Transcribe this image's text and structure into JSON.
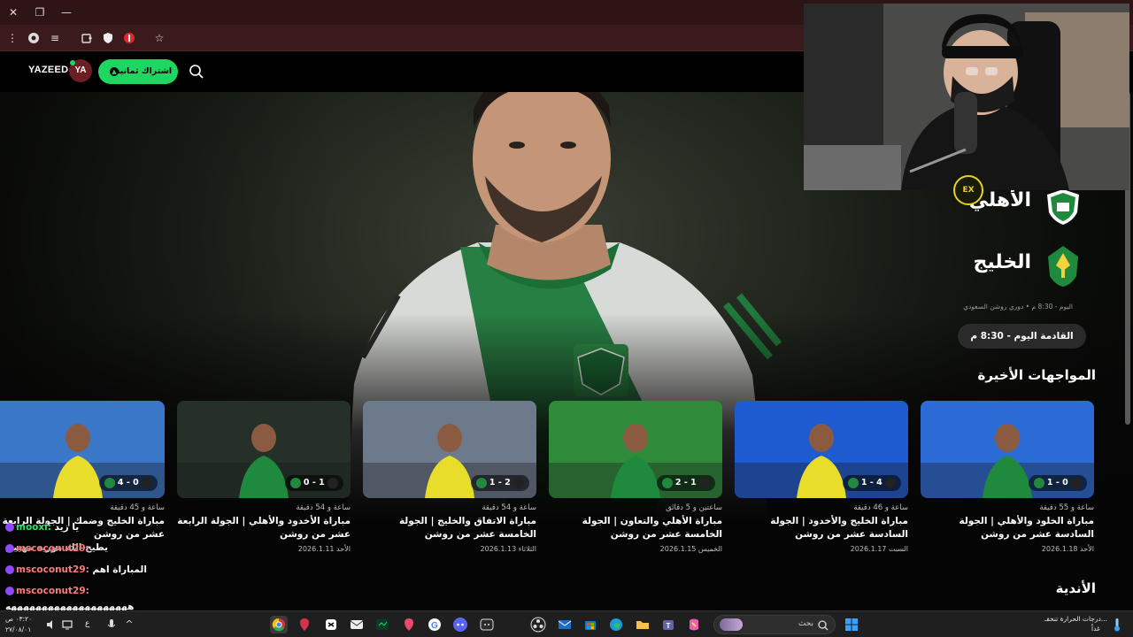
{
  "browser": {
    "window_controls": [
      "✕",
      "❐",
      "—"
    ],
    "menu_icon": "more-vert-icon",
    "bookmark_icon": "star-icon"
  },
  "header": {
    "username": "YAZEED",
    "avatar_initials": "YA",
    "subscribe_label": "اشتراك ثمانية"
  },
  "featured": {
    "team_home": "الأهلي",
    "team_away": "الخليج",
    "meta": "اليوم - 8:30 م • دوري روشن السعودي",
    "upcoming": "القادمة اليوم - 8:30 م"
  },
  "recent": {
    "title": "المواجهات الأخيرة",
    "cards": [
      {
        "ago": "ساعة و 55 دقيقة",
        "title": "مباراة الخلود والأهلي | الجولة السادسة عشر من روشن",
        "date": "الأحد 2026.1.18",
        "score": "1 - 0",
        "accent": "#2b6bd6"
      },
      {
        "ago": "ساعة و 46 دقيقة",
        "title": "مباراة الخليج والأخدود | الجولة السادسة عشر من روشن",
        "date": "السبت 2026.1.17",
        "score": "1 - 4",
        "accent": "#1e5bd0"
      },
      {
        "ago": "ساعتين و 5 دقائق",
        "title": "مباراة الأهلي والتعاون | الجولة الخامسة عشر من روشن",
        "date": "الخميس 2026.1.15",
        "score": "2 - 1",
        "accent": "#2f8a3a"
      },
      {
        "ago": "ساعة و 54 دقيقة",
        "title": "مباراة الاتفاق والخليج | الجولة الخامسة عشر من روشن",
        "date": "الثلاثاء 2026.1.13",
        "score": "1 - 2",
        "accent": "#6c7a8c"
      },
      {
        "ago": "ساعة و 54 دقيقة",
        "title": "مباراة الأخدود والأهلي | الجولة الرابعة عشر من روشن",
        "date": "الأحد 2026.1.11",
        "score": "0 - 1",
        "accent": "#243028"
      },
      {
        "ago": "ساعة و 45 دقيقة",
        "title": "مباراة الخليج وضمك | الجولة الرابعة عشر من روشن",
        "date": "",
        "score": "4 - 0",
        "accent": "#3a77c9"
      }
    ]
  },
  "clubs_title": "الأندية",
  "chat": [
    {
      "user": "mooxi:",
      "msg": "يا زيد",
      "green": true
    },
    {
      "user": "",
      "msg": "يطيح الله موريه مهيين",
      "green": false
    },
    {
      "user": "mscoconut29:",
      "msg": "",
      "green": false
    },
    {
      "user": "mscoconut29:",
      "msg": "المباراة اهم",
      "green": false
    },
    {
      "user": "mscoconut29:",
      "msg": "",
      "green": false
    },
    {
      "user": "",
      "msg": "ههههههههههههههههههههه",
      "green": false
    }
  ],
  "taskbar": {
    "search_placeholder": "بحث",
    "weather_line1": "درجات الحرارة تنخفـ...",
    "weather_line2": "غداً",
    "time": "٠٣:٢٠ ص",
    "date": "٢٧/٠٨/٠١",
    "lang": "ع"
  }
}
